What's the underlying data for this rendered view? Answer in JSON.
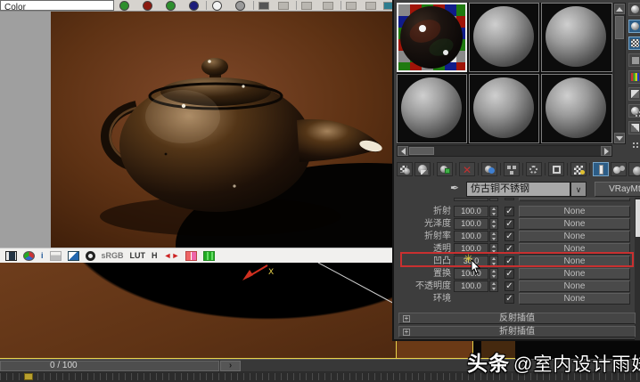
{
  "top_toolbar": {
    "clipped_field_text": "Color",
    "channel_dot_colors": [
      "#2d8f2d",
      "#8a1a10",
      "#2d8f2d",
      "#1c1c7a"
    ]
  },
  "vfb": {
    "icons": [
      "filmstrip-icon",
      "rgb-channels-icon",
      "info-icon",
      "histogram-icon",
      "color-correction-icon",
      "aperture-icon",
      "srgb-icon",
      "lut-icon",
      "h-icon",
      "compare-icon",
      "stamp-icon",
      "region-icon"
    ],
    "info_label": "i",
    "srgb_label": "sRGB",
    "lut_label": "LUT",
    "h_label": "H",
    "compare_label": "◄►"
  },
  "viewport": {
    "axis_label": "X",
    "selection_color": "#e8d24a",
    "gizmo_color": "#d03020"
  },
  "material_editor": {
    "slots": {
      "count": 6,
      "selected_index": 0,
      "selected_slot_name": "antique-copper-material-sphere"
    },
    "side_tool_icons": [
      "sample-type",
      "backlight",
      "background",
      "sample-uv-tiling",
      "video-color-check",
      "options",
      "select-by-material",
      "material-map-navigator",
      "pick-material"
    ],
    "toolbar_icons": [
      "get-material",
      "put-to-scene",
      "assign-to-selection",
      "reset-map",
      "make-unique",
      "put-to-library",
      "material-id-channel",
      "show-map-in-viewport",
      "show-end-result",
      "go-to-parent",
      "go-forward-sibling",
      "pick-from-object"
    ],
    "material_name": "仿古铜不锈钢",
    "material_type_button": "VRayMtl",
    "maps": {
      "rows": [
        {
          "label": "折射",
          "value": "100.0",
          "checked": true,
          "map": "None"
        },
        {
          "label": "光泽度",
          "value": "100.0",
          "checked": true,
          "map": "None"
        },
        {
          "label": "折射率",
          "value": "100.0",
          "checked": true,
          "map": "None"
        },
        {
          "label": "透明",
          "value": "100.0",
          "checked": true,
          "map": "None"
        },
        {
          "label": "凹凸",
          "value": "30.0",
          "checked": true,
          "map": "None",
          "highlighted": true
        },
        {
          "label": "置换",
          "value": "100.0",
          "checked": true,
          "map": "None"
        },
        {
          "label": "不透明度",
          "value": "100.0",
          "checked": true,
          "map": "None"
        },
        {
          "label": "环境",
          "value": null,
          "checked": true,
          "map": "None"
        }
      ],
      "highlight_color": "#c93030"
    },
    "rollouts": [
      {
        "label": "反射插值"
      },
      {
        "label": "折射插值"
      }
    ]
  },
  "timeline": {
    "frame_indicator": "0 / 100",
    "next_frame_glyph": "›"
  },
  "watermark": {
    "brand": "头条",
    "handle": "@室内设计雨妹"
  },
  "glyphs": {
    "check": "✓",
    "plus": "+",
    "dropdown_arrow": "∨",
    "eyedropper": "✒"
  }
}
